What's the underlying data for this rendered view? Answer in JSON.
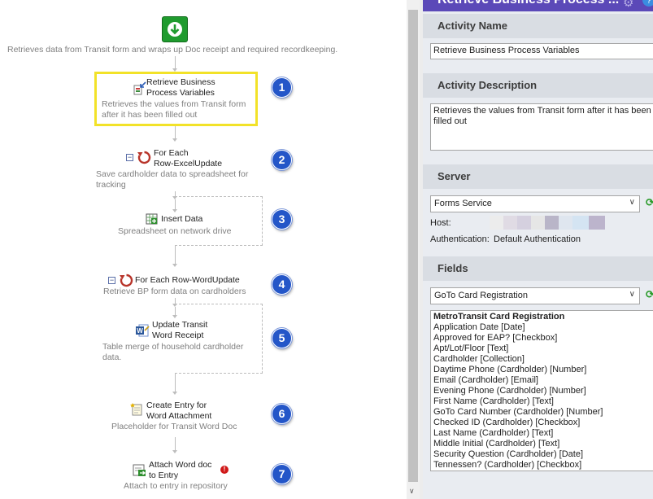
{
  "workflow": {
    "start_description": "Retrieves data from Transit form and wraps up Doc receipt and required recordkeeping.",
    "activities": [
      {
        "title1": "Retrieve Business",
        "title2": "Process Variables",
        "desc1": "Retrieves the values from Transit form",
        "desc2": "after it has been filled out",
        "badge": "1"
      },
      {
        "title1": "For Each",
        "title2": "Row-ExcelUpdate",
        "desc1": "Save cardholder data to spreadsheet for",
        "desc2": "tracking",
        "badge": "2"
      },
      {
        "title1": "Insert Data",
        "desc1": "Spreadsheet on network drive",
        "badge": "3"
      },
      {
        "title1": "For Each Row-WordUpdate",
        "desc1": "Retrieve BP form data on cardholders",
        "badge": "4"
      },
      {
        "title1": "Update Transit",
        "title2": "Word Receipt",
        "desc1": "Table merge of household cardholder",
        "desc2": "data.",
        "badge": "5"
      },
      {
        "title1": "Create Entry for",
        "title2": "Word Attachment",
        "desc1": "Placeholder for Transit Word Doc",
        "badge": "6"
      },
      {
        "title1": "Attach Word doc",
        "title2": "to Entry",
        "desc1": "Attach to entry in repository",
        "badge": "7"
      }
    ],
    "highlight_color": "#f2e228",
    "badge_color": "#2456c8"
  },
  "panel": {
    "header_title": "Retrieve Business Process ...",
    "header_color": "#5b49b8",
    "activity_name_heading": "Activity Name",
    "activity_name_value": "Retrieve Business Process Variables",
    "activity_description_heading": "Activity Description",
    "activity_description_value": "Retrieves the values from Transit form after it has been filled out",
    "server_heading": "Server",
    "server_selected": "Forms Service",
    "host_label": "Host:",
    "auth_label": "Authentication:",
    "auth_value": "Default Authentication",
    "fields_heading": "Fields",
    "fields_selected": "GoTo Card Registration",
    "fields_list_title": "MetroTransit Card Registration",
    "fields_list": [
      "Application Date [Date]",
      "Approved for EAP? [Checkbox]",
      "Apt/Lot/Floor [Text]",
      "Cardholder [Collection]",
      "Daytime Phone (Cardholder) [Number]",
      "Email (Cardholder) [Email]",
      "Evening Phone (Cardholder) [Number]",
      "First Name (Cardholder) [Text]",
      "GoTo Card Number (Cardholder) [Number]",
      "Checked ID (Cardholder) [Checkbox]",
      "Last Name (Cardholder) [Text]",
      "Middle Initial (Cardholder) [Text]",
      "Security Question (Cardholder) [Date]",
      "Tennessen? (Cardholder) [Checkbox]"
    ]
  }
}
